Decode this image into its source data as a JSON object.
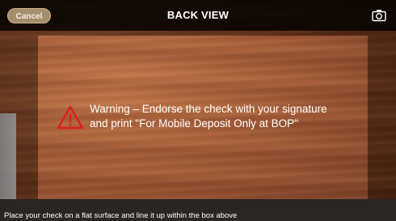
{
  "header": {
    "cancel_label": "Cancel",
    "title": "BACK VIEW",
    "camera_icon": "camera-icon"
  },
  "overlay": {
    "warning_icon": "warning-triangle-icon",
    "warning_color": "#e0201b",
    "warning_line1": "Warning – Endorse the check with your signature",
    "warning_line2": "and print \"For Mobile Deposit Only at BOP\""
  },
  "footer": {
    "instruction": "Place your check on a flat surface and line it up within the box above"
  }
}
